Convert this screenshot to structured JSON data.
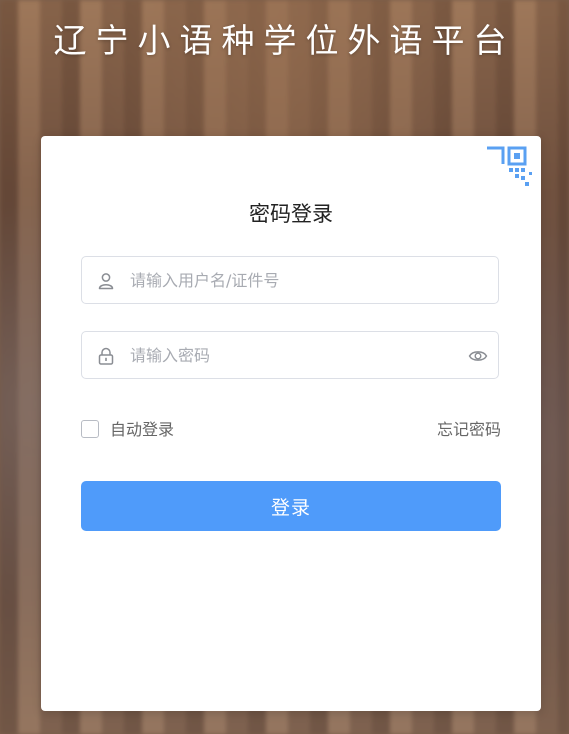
{
  "page": {
    "title": "辽宁小语种学位外语平台"
  },
  "login": {
    "heading": "密码登录",
    "username_placeholder": "请输入用户名/证件号",
    "username_value": "",
    "password_placeholder": "请输入密码",
    "password_value": "",
    "auto_login_label": "自动登录",
    "auto_login_checked": false,
    "forgot_label": "忘记密码",
    "submit_label": "登录"
  },
  "icons": {
    "qr": "qr-code-icon",
    "user": "user-icon",
    "lock": "lock-icon",
    "eye": "eye-icon"
  },
  "colors": {
    "primary": "#4f9bfa",
    "qr_accent": "#5aa0f2",
    "border": "#dcdfe6",
    "placeholder": "#a8abb2"
  }
}
